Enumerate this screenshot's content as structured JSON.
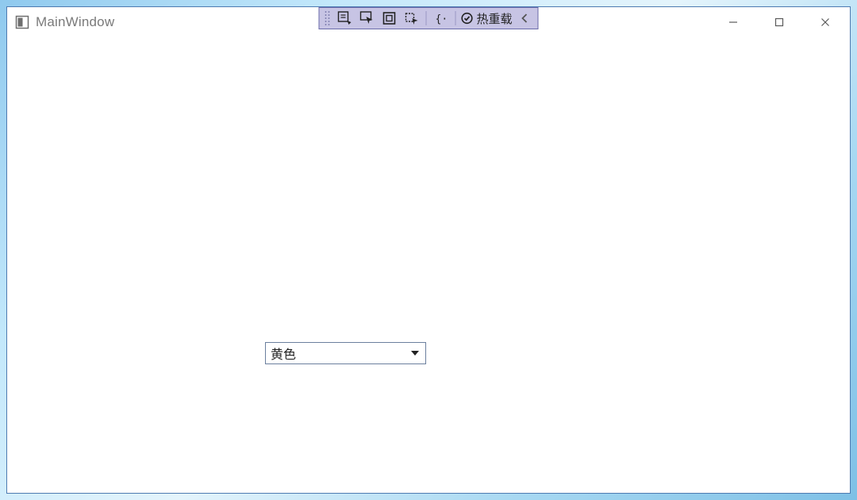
{
  "window": {
    "title": "MainWindow"
  },
  "debug_toolbar": {
    "hot_reload_label": "热重载"
  },
  "combobox": {
    "selected": "黄色"
  }
}
